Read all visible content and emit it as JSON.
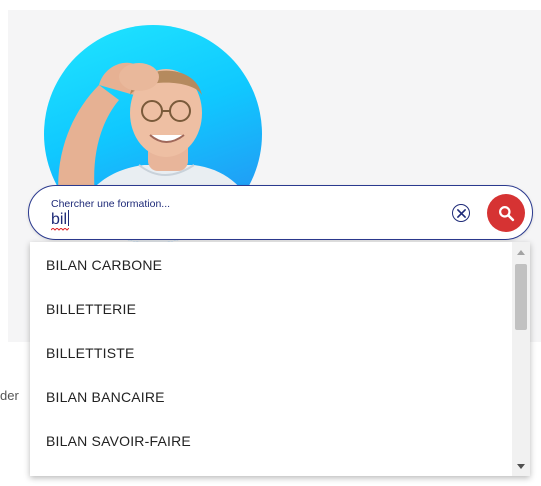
{
  "hero": {
    "side_text": "der"
  },
  "search": {
    "label": "Chercher une formation...",
    "value": "bil",
    "clear_icon": "clear-circle-icon",
    "search_icon": "magnifier-icon",
    "accent_color": "#d63333",
    "border_color": "#2b3a8f"
  },
  "suggestions": {
    "items": [
      {
        "label": "BILAN CARBONE"
      },
      {
        "label": "BILLETTERIE"
      },
      {
        "label": "BILLETTISTE"
      },
      {
        "label": "BILAN BANCAIRE"
      },
      {
        "label": "BILAN SAVOIR-FAIRE"
      }
    ]
  }
}
